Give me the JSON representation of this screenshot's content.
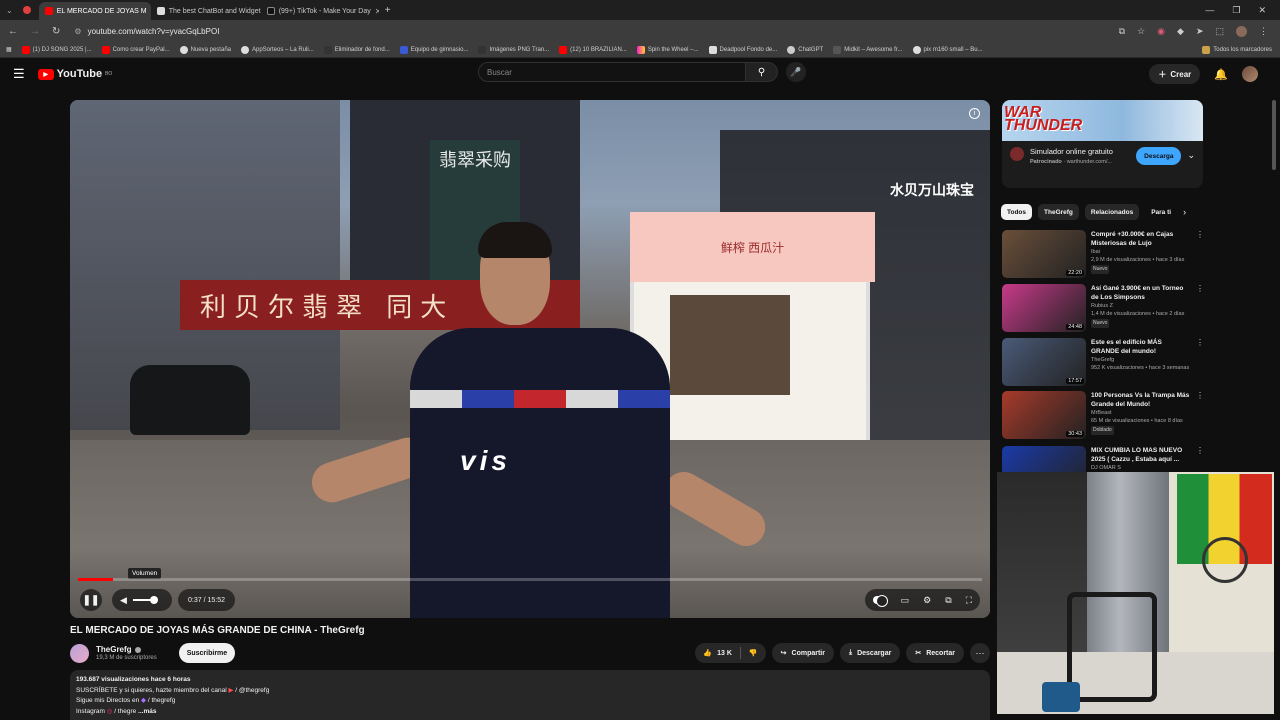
{
  "browser": {
    "tabs": [
      {
        "label": "EL MERCADO DE JOYAS M",
        "active": true
      },
      {
        "label": "The best ChatBot and Widget",
        "active": false
      },
      {
        "label": "(99+) TikTok - Make Your Day",
        "active": false
      }
    ],
    "url": "youtube.com/watch?v=yvacGqLbPOI",
    "bookmarks": [
      "(1) DJ SONG 2025 |...",
      "Como crear PayPal...",
      "Nueva pestaña",
      "AppSorteos – La Ruli...",
      "Eliminador de fond...",
      "Equipo de gimnasio...",
      "Imágenes PNG Tran...",
      "(12) 10 BRAZILIAN...",
      "Spin the Wheel –...",
      "Deadpool Fondo de...",
      "ChatGPT",
      "Midkit – Awesome fr...",
      "pix m160 small – Bu..."
    ],
    "bookmarks_all": "Todos los marcadores"
  },
  "youtube": {
    "logo_text": "YouTube",
    "logo_region": "BO",
    "search_placeholder": "Buscar",
    "create_label": "Crear"
  },
  "player": {
    "tooltip": "Volumen",
    "time": "0:37 / 15:52",
    "progress_fraction": 0.039,
    "volume_fraction": 1.0,
    "scene_sign_left": "利贝尔翡翠 同大",
    "scene_sign_mid": "翡翠采购",
    "scene_sign_kiosk": "鲜榨 西瓜汁",
    "scene_sign_right": "水贝万山珠宝",
    "jacket_text": "vis"
  },
  "video": {
    "title": "EL MERCADO DE JOYAS MÁS GRANDE DE CHINA - TheGrefg",
    "channel": "TheGrefg",
    "subscribers": "19,3 M de suscriptores",
    "subscribe_label": "Suscribirme",
    "likes": "13 K",
    "share_label": "Compartir",
    "download_label": "Descargar",
    "clip_label": "Recortar"
  },
  "description": {
    "stats": "193.687 visualizaciones  hace 6 horas",
    "line1": "SUSCRÍBETE y si quieres, hazte miembro del canal",
    "line1_handle": "/ @thegrefg",
    "line2": "Sigue mis Directos en",
    "line2_handle": "/ thegrefg",
    "line3": "Instagram",
    "line3_handle": "/ thegre",
    "more": "...más"
  },
  "ad": {
    "logo_line1": "WAR",
    "logo_line2": "THUNDER",
    "title": "Simulador online gratuito",
    "sponsored": "Patrocinado",
    "domain": "warthunder.com/...",
    "cta": "Descarga"
  },
  "chips": [
    "Todos",
    "TheGrefg",
    "Relacionados",
    "Para ti"
  ],
  "recommendations": [
    {
      "title": "Compré +30.000€ en Cajas Misteriosas de Lujo",
      "channel": "Ibai",
      "meta": "2,9 M de visualizaciones • hace 3 días",
      "badge": "Nuevo",
      "duration": "22:20",
      "thumb_color": "#6a4f3a"
    },
    {
      "title": "Así Gané 3.900€ en un Torneo de Los Simpsons",
      "channel": "Rubius Z",
      "meta": "1,4 M de visualizaciones • hace 2 días",
      "badge": "Nuevo",
      "duration": "24:48",
      "thumb_color": "#c83a8a"
    },
    {
      "title": "Este es el edificio MÁS GRANDE del mundo!",
      "channel": "TheGrefg",
      "meta": "952 K visualizaciones • hace 3 semanas",
      "badge": "",
      "duration": "17:57",
      "thumb_color": "#4a5a78"
    },
    {
      "title": "100 Personas Vs la Trampa Más Grande del Mundo!",
      "channel": "MrBeast",
      "meta": "65 M de visualizaciones • hace 8 días",
      "badge": "Doblado",
      "duration": "30:43",
      "thumb_color": "#a83a2a"
    },
    {
      "title": "MIX CUMBIA LO MAS NUEVO 2025 ( Cazzu , Estaba aquí ...",
      "channel": "DJ OMAR S",
      "meta": "",
      "badge": "",
      "duration": "",
      "thumb_color": "#1a3aa8"
    }
  ],
  "colors": {
    "yt_red": "#ff0000",
    "accent_blue": "#3ea6ff",
    "bg": "#0f0f0f"
  }
}
